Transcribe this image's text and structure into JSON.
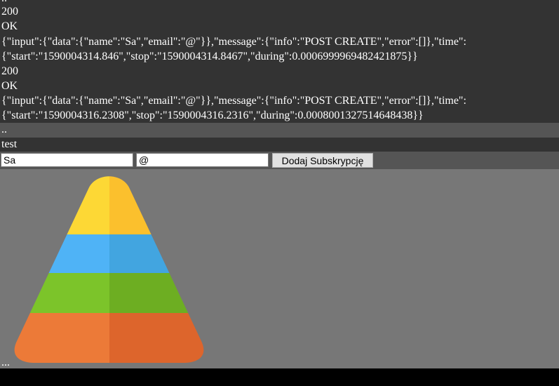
{
  "log": {
    "top_marker": "..",
    "entries": [
      {
        "status_code": "200",
        "status_text": "OK",
        "json_line_1": "{\"input\":{\"data\":{\"name\":\"Sa\",\"email\":\"@\"}},\"message\":{\"info\":\"POST CREATE\",\"error\":[]},\"time\":",
        "json_line_2": "{\"start\":\"1590004314.846\",\"stop\":\"1590004314.8467\",\"during\":0.0006999969482421875}}"
      },
      {
        "status_code": "200",
        "status_text": "OK",
        "json_line_1": "{\"input\":{\"data\":{\"name\":\"Sa\",\"email\":\"@\"}},\"message\":{\"info\":\"POST CREATE\",\"error\":[]},\"time\":",
        "json_line_2": "{\"start\":\"1590004316.2308\",\"stop\":\"1590004316.2316\",\"during\":0.0008001327514648438}}"
      }
    ]
  },
  "separator": {
    "text": ".."
  },
  "section": {
    "title": "test"
  },
  "form": {
    "name_value": "Sa",
    "email_value": "@",
    "submit_label": "Dodaj Subskrypcję"
  },
  "footer": {
    "marker": "..."
  },
  "colors": {
    "log_background": "#333333",
    "separator_background": "#555555",
    "content_background": "#777777",
    "pyramid_layers": [
      {
        "left": "#FDD835",
        "right": "#FBC02D"
      },
      {
        "left": "#4FB3F6",
        "right": "#42A5E0"
      },
      {
        "left": "#7CC42A",
        "right": "#6DAE22"
      },
      {
        "left": "#EC7A38",
        "right": "#DD652C"
      }
    ]
  }
}
